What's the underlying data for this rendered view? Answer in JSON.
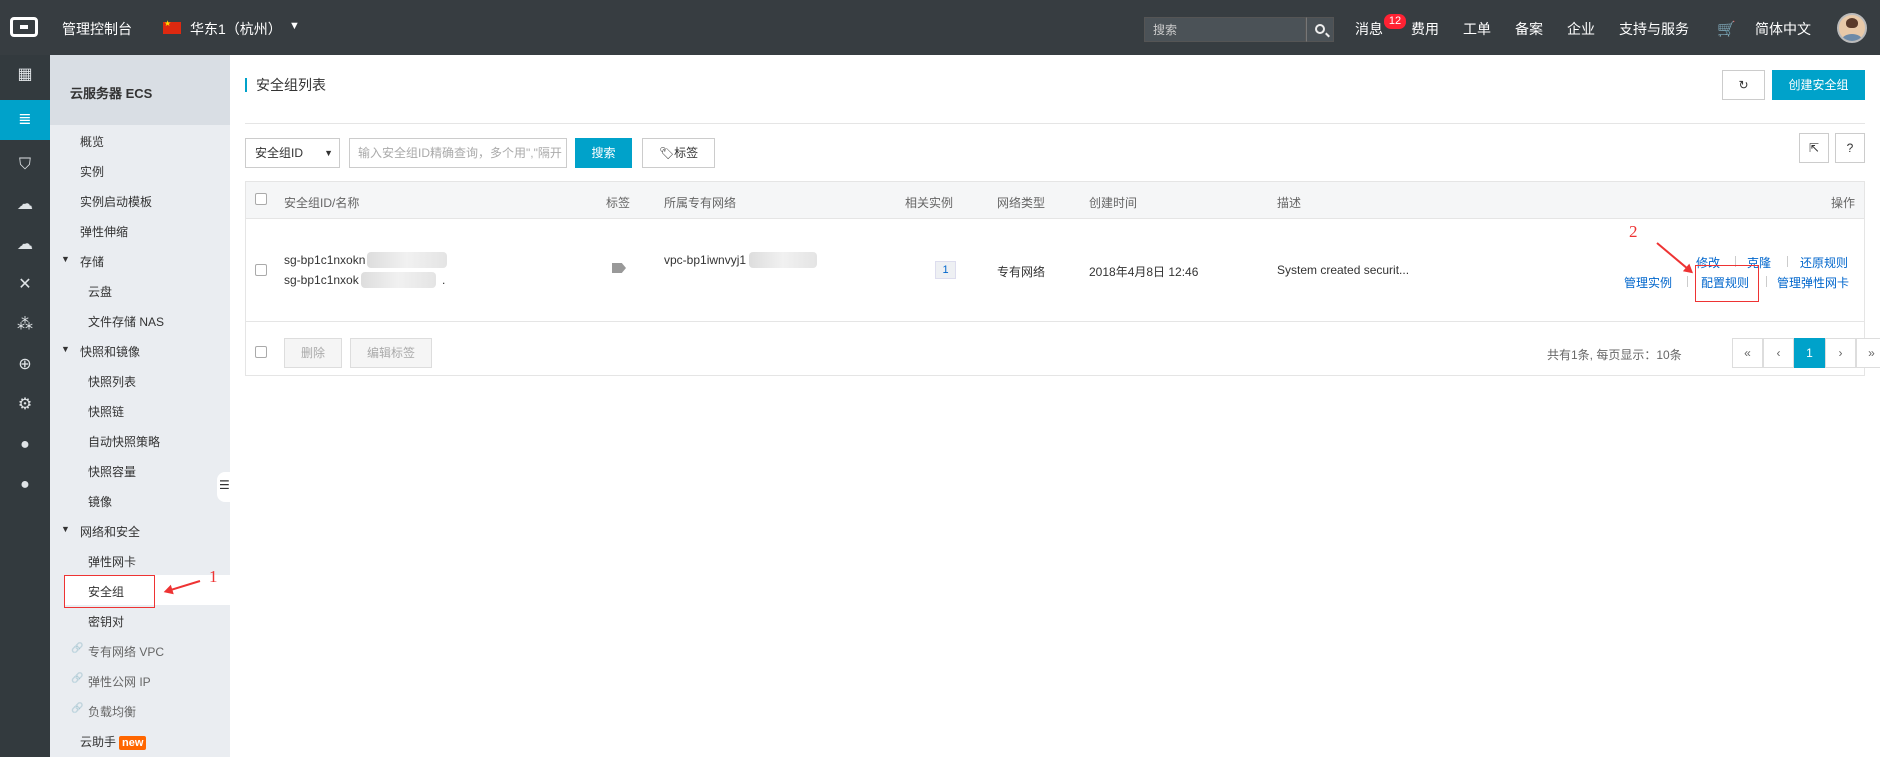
{
  "topbar": {
    "console": "管理控制台",
    "region": "华东1（杭州）",
    "search_placeholder": "搜索",
    "nav": [
      "消息",
      "费用",
      "工单",
      "备案",
      "企业",
      "支持与服务",
      "简体中文"
    ],
    "message_badge": "12"
  },
  "sidebar": {
    "title": "云服务器 ECS",
    "items": [
      {
        "label": "概览"
      },
      {
        "label": "实例"
      },
      {
        "label": "实例启动模板"
      },
      {
        "label": "弹性伸缩"
      },
      {
        "label": "存储"
      },
      {
        "label": "云盘"
      },
      {
        "label": "文件存储 NAS"
      },
      {
        "label": "快照和镜像"
      },
      {
        "label": "快照列表"
      },
      {
        "label": "快照链"
      },
      {
        "label": "自动快照策略"
      },
      {
        "label": "快照容量"
      },
      {
        "label": "镜像"
      },
      {
        "label": "网络和安全"
      },
      {
        "label": "弹性网卡"
      },
      {
        "label": "安全组"
      },
      {
        "label": "密钥对"
      },
      {
        "label": "专有网络 VPC"
      },
      {
        "label": "弹性公网 IP"
      },
      {
        "label": "负载均衡"
      },
      {
        "label": "云助手"
      }
    ],
    "new_tag": "new"
  },
  "main": {
    "title": "安全组列表",
    "create_button": "创建安全组",
    "select_value": "安全组ID",
    "query_placeholder": "输入安全组ID精确查询，多个用\",\"隔开",
    "search_button": "搜索",
    "tag_button": "标签",
    "help_button": "?"
  },
  "table": {
    "headers": [
      "安全组ID/名称",
      "标签",
      "所属专有网络",
      "相关实例",
      "网络类型",
      "创建时间",
      "描述",
      "操作"
    ],
    "row": {
      "id": "sg-bp1c1nxokn",
      "name": "sg-bp1c1nxok",
      "name_suffix": ".",
      "vpc": "vpc-bp1iwnvyj1",
      "instances": "1",
      "network_type": "专有网络",
      "created": "2018年4月8日 12:46",
      "description": "System created securit...",
      "actions": [
        "修改",
        "克隆",
        "还原规则",
        "管理实例",
        "配置规则",
        "管理弹性网卡"
      ]
    },
    "footer": {
      "delete": "删除",
      "edit_tags": "编辑标签",
      "summary": "共有1条, 每页显示：10条",
      "pages": [
        "«",
        "‹",
        "1",
        "›",
        "»"
      ]
    }
  },
  "annotations": {
    "one": "1",
    "two": "2"
  },
  "colors": {
    "accent": "#00a2ca",
    "topbar": "#373d41",
    "annotation": "#e33333"
  }
}
